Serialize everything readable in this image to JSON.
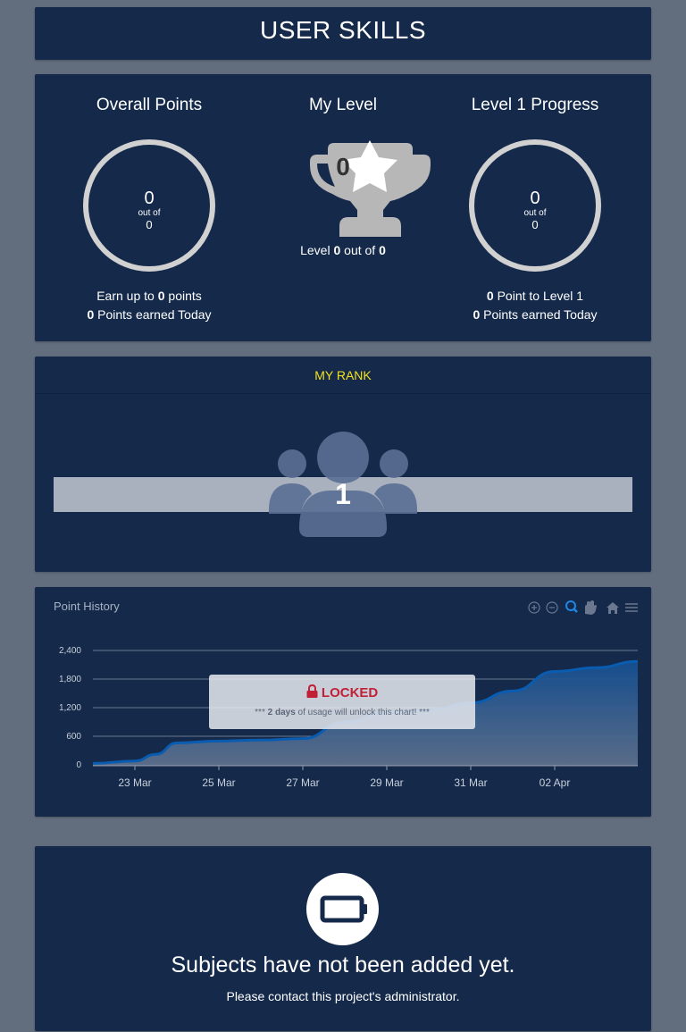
{
  "title": "USER SKILLS",
  "overall": {
    "heading": "Overall Points",
    "value": "0",
    "out_of": "out of",
    "total": "0",
    "earn_prefix": "Earn up to",
    "earn_value": "0",
    "earn_suffix": "points",
    "today_value": "0",
    "today_label": "Points earned Today"
  },
  "level": {
    "heading": "My Level",
    "star_value": "0",
    "prefix": "Level",
    "value": "0",
    "out_of": "out of",
    "total": "0"
  },
  "progress": {
    "heading": "Level 1 Progress",
    "value": "0",
    "out_of": "out of",
    "total": "0",
    "next_value": "0",
    "next_label": "Point to Level 1",
    "today_value": "0",
    "today_label": "Points earned Today"
  },
  "rank": {
    "heading": "MY RANK",
    "value": "1",
    "accent": "#f2e21a"
  },
  "history": {
    "heading": "Point History",
    "tools": [
      "zoom-in-icon",
      "zoom-out-icon",
      "zoom-selection-icon",
      "pan-hand-icon",
      "home-reset-icon",
      "menu-icon"
    ],
    "lock_title": "LOCKED",
    "lock_pre": "***",
    "lock_days": "2 days",
    "lock_post": "of usage will unlock this chart! ***"
  },
  "chart_data": {
    "type": "area",
    "title": "",
    "xlabel": "",
    "ylabel": "",
    "ylim": [
      0,
      2400
    ],
    "yticks": [
      "2,400",
      "1,800",
      "1,200",
      "600",
      "0"
    ],
    "ytick_values": [
      2400,
      1800,
      1200,
      600,
      0
    ],
    "xticks": [
      "23 Mar",
      "25 Mar",
      "27 Mar",
      "29 Mar",
      "31 Mar",
      "02 Apr"
    ],
    "x": [
      "22 Mar",
      "23 Mar",
      "23.5 Mar",
      "24 Mar",
      "25 Mar",
      "26 Mar",
      "27 Mar",
      "28 Mar",
      "29 Mar",
      "30 Mar",
      "31 Mar",
      "01 Apr",
      "02 Apr",
      "03 Apr",
      "04 Apr"
    ],
    "x_pos": [
      -1,
      0,
      0.5,
      1,
      2,
      3,
      4,
      5,
      6,
      7,
      8,
      9,
      10,
      11,
      12
    ],
    "values": [
      30,
      80,
      220,
      460,
      500,
      520,
      550,
      900,
      1100,
      1150,
      1300,
      1550,
      1960,
      2040,
      2170
    ],
    "colors": {
      "line": "#0a5cb0",
      "fill_top": "#154f91",
      "fill_bottom": "#5c6f8b"
    }
  },
  "subjects": {
    "title": "Subjects have not been added yet.",
    "subtitle": "Please contact this project's administrator."
  }
}
